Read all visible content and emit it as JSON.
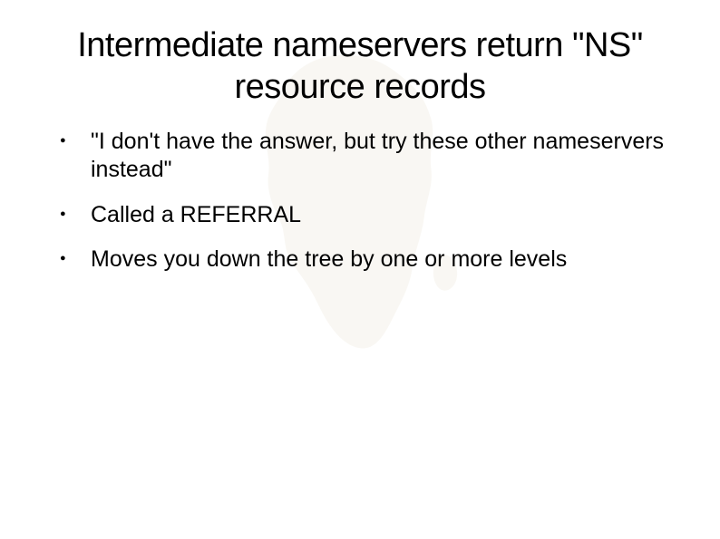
{
  "title": "Intermediate nameservers return \"NS\" resource records",
  "bullets": [
    "\"I don't have the answer, but try these other nameservers instead\"",
    "Called a REFERRAL",
    "Moves you down the tree by one or more levels"
  ]
}
